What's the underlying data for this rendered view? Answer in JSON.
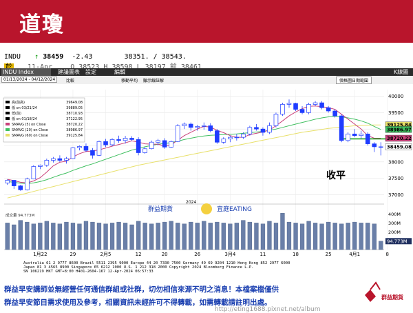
{
  "header": {
    "title": "道瓊"
  },
  "quote": {
    "ticker": "INDU",
    "arrow": "↑",
    "last": "38459",
    "change": "-2.43",
    "bidask": "38351. / 38543.",
    "date": "11-Apr",
    "open_label": "O",
    "open": "38523",
    "high_label": "H",
    "high": "38598",
    "low_label": "L",
    "low": "38197",
    "prev_label": "前",
    "prev": "38461",
    "daily_label": "於"
  },
  "menu": {
    "index_name": "INDU Index",
    "item1": "建議圖表",
    "item2": "設定",
    "item3": "編輯",
    "right_label": "K線圖"
  },
  "controls": {
    "date_range": "01/13/2024 - 04/12/2024",
    "compare_label": "比較",
    "chk1": "移動平均",
    "chk2": "顯示線",
    "chk3": "註解",
    "period_right": "價格圖日期範圍"
  },
  "legend": {
    "lines": [
      {
        "label": "高(前高)",
        "value": "39649.08"
      },
      {
        "label": "低 on 03/21/24",
        "value": "39889.05"
      },
      {
        "label": "低(前)",
        "value": "38710.93"
      },
      {
        "label": "低 on 01/18/24",
        "value": "37122.95"
      },
      {
        "label": "SMAVG (5) on Close",
        "value": "38720.22"
      },
      {
        "label": "SMAVG (20) on Close",
        "value": "38986.97"
      },
      {
        "label": "SMAVG (60) on Close",
        "value": "39125.84"
      }
    ]
  },
  "annotation": "收平",
  "volume_legend": "成交量 94.773M",
  "footer_market_1": "Australia 61 2 9777 8600 Brazil 5511 2395 9000 Europe 44 20 7330 7500 Germany 49 69 9204 1210 Hong Kong 852 2977 6000",
  "footer_market_2": "Japan 81 3 4565 8900     Singapore 65 6212 1000     U.S. 1 212 318 2000     Copyright 2024 Bloomberg Finance L.P.",
  "footer_market_3": "SN 106219 HKT GMT+8:00 H401-2604-167 12-Apr-2024 06:57:33",
  "watermark": {
    "brand": "群益期貨",
    "slogan": "宜庭EATING"
  },
  "notes": {
    "line1": "群益早安講師並無經營任何通信群組或社群，切勿相信來源不明之消息！本檔案檔僅供",
    "line2": "群益早安節目需求使用及參考，相關資訊未經許可不得轉載，如需轉載請註明出處。",
    "logo_text": "群益期貨",
    "url": "http://eting1688.pixnet.net/album"
  },
  "colors": {
    "up": "#1f3cff",
    "down": "#1f3cff",
    "sma5": "#c9407a",
    "sma20": "#3fbf5f",
    "sma60": "#e8e06a",
    "ref": "#18a018",
    "brand": "#b9152c"
  },
  "chart_data": {
    "type": "candlestick",
    "price_axis": {
      "ylim": [
        36800,
        40200
      ],
      "ticks": [
        37000,
        37500,
        38000,
        38500,
        39000,
        39500,
        40000
      ]
    },
    "price_tags": [
      {
        "value": 39125.84,
        "text": "39125.84",
        "color": "#e8e06a"
      },
      {
        "value": 38986.97,
        "text": "38986.97",
        "color": "#3fbf5f"
      },
      {
        "value": 38720.22,
        "text": "38720.22",
        "color": "#c9407a"
      },
      {
        "value": 38459.08,
        "text": "38459.08",
        "color": "#ffffff"
      }
    ],
    "volume_axis": {
      "ylim": [
        0,
        420
      ],
      "ticks": [
        {
          "v": 400,
          "t": "400M"
        },
        {
          "v": 300,
          "t": "300M"
        },
        {
          "v": 200,
          "t": "200M"
        },
        {
          "v": 100,
          "t": "100M"
        }
      ],
      "last_tag": "94.773M"
    },
    "x_labels": [
      {
        "i": 5,
        "t": "1月22"
      },
      {
        "i": 10,
        "t": "29"
      },
      {
        "i": 15,
        "t": "2月5"
      },
      {
        "i": 20,
        "t": "12"
      },
      {
        "i": 24,
        "t": "20"
      },
      {
        "i": 29,
        "t": "26"
      },
      {
        "i": 34,
        "t": "3月4"
      },
      {
        "i": 39,
        "t": "11"
      },
      {
        "i": 44,
        "t": "18"
      },
      {
        "i": 49,
        "t": "25"
      },
      {
        "i": 53,
        "t": "4月1"
      },
      {
        "i": 58,
        "t": "8"
      }
    ],
    "year_label": "2024",
    "candles": [
      [
        37360,
        37470,
        37300,
        37440
      ],
      [
        37440,
        37450,
        37180,
        37270
      ],
      [
        37270,
        37300,
        37120,
        37150
      ],
      [
        37150,
        37520,
        37130,
        37480
      ],
      [
        37480,
        37900,
        37470,
        37860
      ],
      [
        37860,
        37920,
        37780,
        37900
      ],
      [
        37900,
        38100,
        37850,
        38050
      ],
      [
        38050,
        38150,
        37980,
        38100
      ],
      [
        38100,
        38200,
        38000,
        38050
      ],
      [
        38050,
        38150,
        37950,
        38100
      ],
      [
        38100,
        38450,
        38090,
        38430
      ],
      [
        38430,
        38500,
        38350,
        38470
      ],
      [
        38470,
        38560,
        38300,
        38350
      ],
      [
        38350,
        38420,
        38100,
        38200
      ],
      [
        38200,
        38650,
        38180,
        38620
      ],
      [
        38620,
        38700,
        38450,
        38520
      ],
      [
        38520,
        38720,
        38480,
        38680
      ],
      [
        38680,
        38800,
        38580,
        38650
      ],
      [
        38650,
        38790,
        38560,
        38720
      ],
      [
        38720,
        38780,
        38640,
        38680
      ],
      [
        38680,
        38750,
        38200,
        38280
      ],
      [
        38280,
        38450,
        38250,
        38400
      ],
      [
        38400,
        38650,
        38380,
        38600
      ],
      [
        38600,
        38700,
        38500,
        38650
      ],
      [
        38650,
        38720,
        38400,
        38450
      ],
      [
        38450,
        38650,
        38430,
        38620
      ],
      [
        38620,
        39150,
        38600,
        39100
      ],
      [
        39100,
        39200,
        39000,
        39150
      ],
      [
        39150,
        39200,
        38950,
        39050
      ],
      [
        39050,
        39130,
        38950,
        39080
      ],
      [
        39080,
        39200,
        38980,
        39100
      ],
      [
        39100,
        39180,
        38900,
        38950
      ],
      [
        38950,
        39000,
        38550,
        38600
      ],
      [
        38600,
        38750,
        38550,
        38700
      ],
      [
        38700,
        38800,
        38600,
        38750
      ],
      [
        38750,
        38850,
        38650,
        38750
      ],
      [
        38750,
        38900,
        38700,
        38850
      ],
      [
        38850,
        39100,
        38800,
        39050
      ],
      [
        39050,
        39150,
        38950,
        39000
      ],
      [
        39000,
        39050,
        38800,
        38900
      ],
      [
        38900,
        39200,
        38850,
        39100
      ],
      [
        39100,
        39500,
        39050,
        39450
      ],
      [
        39450,
        39800,
        39400,
        39750
      ],
      [
        39750,
        39900,
        39650,
        39780
      ],
      [
        39780,
        39800,
        39550,
        39600
      ],
      [
        39600,
        39700,
        39450,
        39500
      ],
      [
        39500,
        39800,
        39450,
        39750
      ],
      [
        39750,
        39850,
        39700,
        39800
      ],
      [
        39800,
        39850,
        39600,
        39650
      ],
      [
        39650,
        39700,
        39500,
        39550
      ],
      [
        39550,
        39600,
        39350,
        39400
      ],
      [
        39400,
        39450,
        38600,
        38650
      ],
      [
        38650,
        38900,
        38600,
        38850
      ],
      [
        38850,
        39000,
        38750,
        38800
      ],
      [
        38800,
        38950,
        38700,
        38850
      ],
      [
        38850,
        38900,
        38500,
        38550
      ],
      [
        38550,
        38600,
        38300,
        38460
      ],
      [
        38460,
        38598,
        38197,
        38459
      ]
    ],
    "volume": [
      300,
      280,
      330,
      310,
      290,
      300,
      320,
      300,
      290,
      310,
      300,
      290,
      320,
      310,
      300,
      290,
      300,
      310,
      300,
      280,
      320,
      300,
      290,
      300,
      310,
      320,
      300,
      290,
      310,
      300,
      320,
      300,
      310,
      300,
      290,
      300,
      330,
      310,
      300,
      290,
      320,
      300,
      410,
      310,
      300,
      290,
      320,
      300,
      290,
      310,
      300,
      290,
      300,
      310,
      300,
      300,
      290,
      95
    ],
    "sma5": [
      37470,
      37430,
      37380,
      37360,
      37420,
      37520,
      37690,
      37880,
      37990,
      38020,
      38150,
      38250,
      38320,
      38330,
      38370,
      38420,
      38480,
      38530,
      38580,
      38640,
      38600,
      38550,
      38540,
      38540,
      38480,
      38520,
      38660,
      38800,
      38900,
      39000,
      39080,
      39060,
      38960,
      38890,
      38800,
      38750,
      38750,
      38830,
      38870,
      38910,
      38970,
      39100,
      39250,
      39400,
      39520,
      39620,
      39690,
      39700,
      39680,
      39650,
      39600,
      39450,
      39300,
      39150,
      39000,
      38800,
      38720,
      38720
    ],
    "sma20": [
      37400,
      37380,
      37350,
      37340,
      37360,
      37400,
      37460,
      37530,
      37600,
      37660,
      37740,
      37810,
      37880,
      37940,
      38010,
      38080,
      38150,
      38220,
      38290,
      38360,
      38410,
      38460,
      38500,
      38540,
      38560,
      38590,
      38630,
      38680,
      38720,
      38760,
      38790,
      38810,
      38820,
      38830,
      38840,
      38850,
      38870,
      38890,
      38910,
      38930,
      38960,
      39000,
      39050,
      39100,
      39150,
      39200,
      39250,
      39300,
      39340,
      39370,
      39390,
      39370,
      39340,
      39300,
      39250,
      39180,
      39080,
      38987
    ],
    "sma60": [
      36900,
      36950,
      37000,
      37050,
      37100,
      37150,
      37200,
      37250,
      37300,
      37350,
      37400,
      37450,
      37500,
      37550,
      37600,
      37650,
      37700,
      37750,
      37800,
      37850,
      37900,
      37940,
      37980,
      38020,
      38060,
      38100,
      38140,
      38180,
      38220,
      38260,
      38300,
      38340,
      38380,
      38420,
      38460,
      38500,
      38540,
      38580,
      38620,
      38660,
      38700,
      38740,
      38780,
      38820,
      38860,
      38900,
      38930,
      38960,
      38990,
      39020,
      39040,
      39060,
      39080,
      39100,
      39110,
      39120,
      39125,
      39126
    ],
    "ref_line": 38700
  }
}
